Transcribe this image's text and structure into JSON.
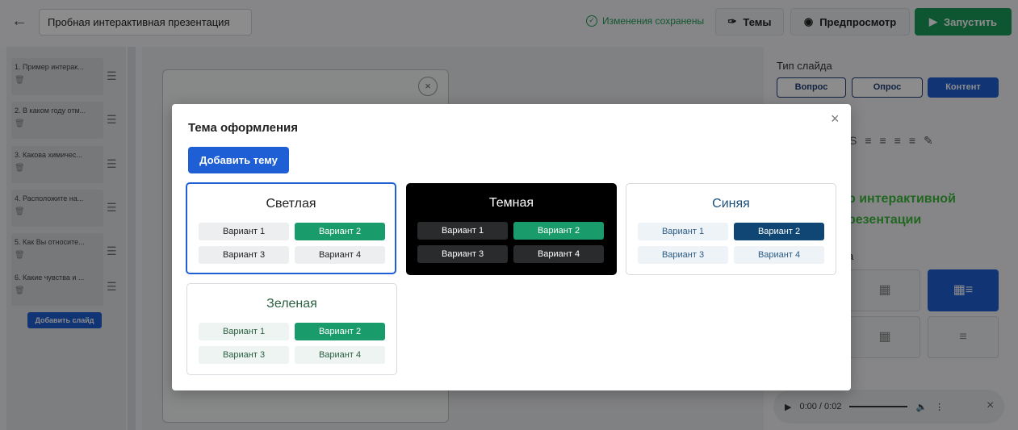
{
  "header": {
    "title": "Пробная интерактивная презентация",
    "saved_status": "Изменения сохранены",
    "themes_label": "Темы",
    "preview_label": "Предпросмотр",
    "run_label": "Запустить"
  },
  "sidebar": {
    "slides": [
      {
        "label": "1. Пример интерак..."
      },
      {
        "label": "2. В каком году отм..."
      },
      {
        "label": "3. Какова химичес..."
      },
      {
        "label": "4. Расположите на..."
      },
      {
        "label": "5. Как Вы относите..."
      },
      {
        "label": "6. Какие чувства и ..."
      }
    ],
    "add_slide_label": "Добавить слайд"
  },
  "right_panel": {
    "slide_type_label": "Тип слайда",
    "types": [
      "Вопрос",
      "Опрос",
      "Контент"
    ],
    "active_type": "Контент",
    "preview_line1": "р интерактивной",
    "preview_line2": "резентации",
    "layout_label_fragment": "а",
    "audio_time": "0:00 / 0:02"
  },
  "modal": {
    "title": "Тема оформления",
    "add_theme_label": "Добавить тему",
    "selected_theme": "Светлая",
    "themes": [
      {
        "name": "Светлая",
        "options": [
          "Вариант 1",
          "Вариант 2",
          "Вариант 3",
          "Вариант 4"
        ]
      },
      {
        "name": "Темная",
        "options": [
          "Вариант 1",
          "Вариант 2",
          "Вариант 3",
          "Вариант 4"
        ]
      },
      {
        "name": "Синяя",
        "options": [
          "Вариант 1",
          "Вариант 2",
          "Вариант 3",
          "Вариант 4"
        ]
      },
      {
        "name": "Зеленая",
        "options": [
          "Вариант 1",
          "Вариант 2",
          "Вариант 3",
          "Вариант 4"
        ]
      }
    ]
  },
  "colors": {
    "accent_blue": "#1f5fd6",
    "success_green": "#1a9b5b",
    "theme_highlight": "#1a9b6c"
  }
}
